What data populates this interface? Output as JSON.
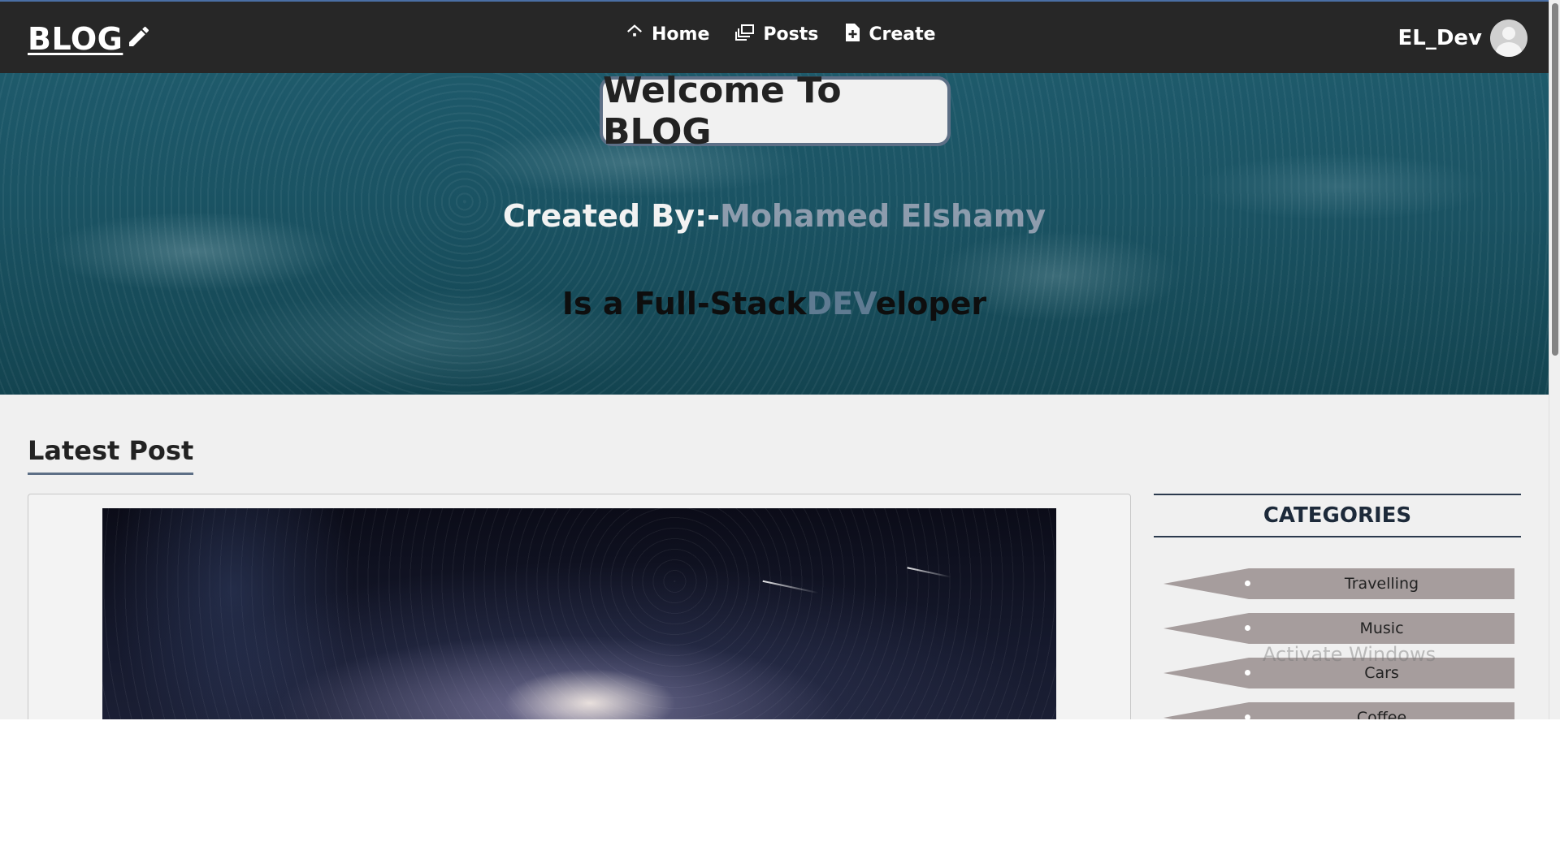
{
  "navbar": {
    "logo": "BLOG",
    "links": [
      {
        "label": "Home",
        "icon": "home-icon"
      },
      {
        "label": "Posts",
        "icon": "posts-icon"
      },
      {
        "label": "Create",
        "icon": "create-icon"
      }
    ],
    "username": "EL_Dev"
  },
  "hero": {
    "welcome": "Welcome To BLOG",
    "created_prefix": "Created By:-",
    "created_name": "Mohamed Elshamy",
    "tagline_before": "Is a Full-Stack",
    "tagline_highlight": "DEV",
    "tagline_after": "eloper"
  },
  "main": {
    "latest_title": "Latest Post"
  },
  "sidebar": {
    "categories_title": "CATEGORIES",
    "items": [
      "Travelling",
      "Music",
      "Cars",
      "Coffee"
    ]
  },
  "overlay": {
    "watermark": "Activate Windows"
  },
  "colors": {
    "navbar": "#272727",
    "accent": "#5d6f86",
    "category_bg": "#a69d9d",
    "page_bg": "#f0f0f0"
  }
}
